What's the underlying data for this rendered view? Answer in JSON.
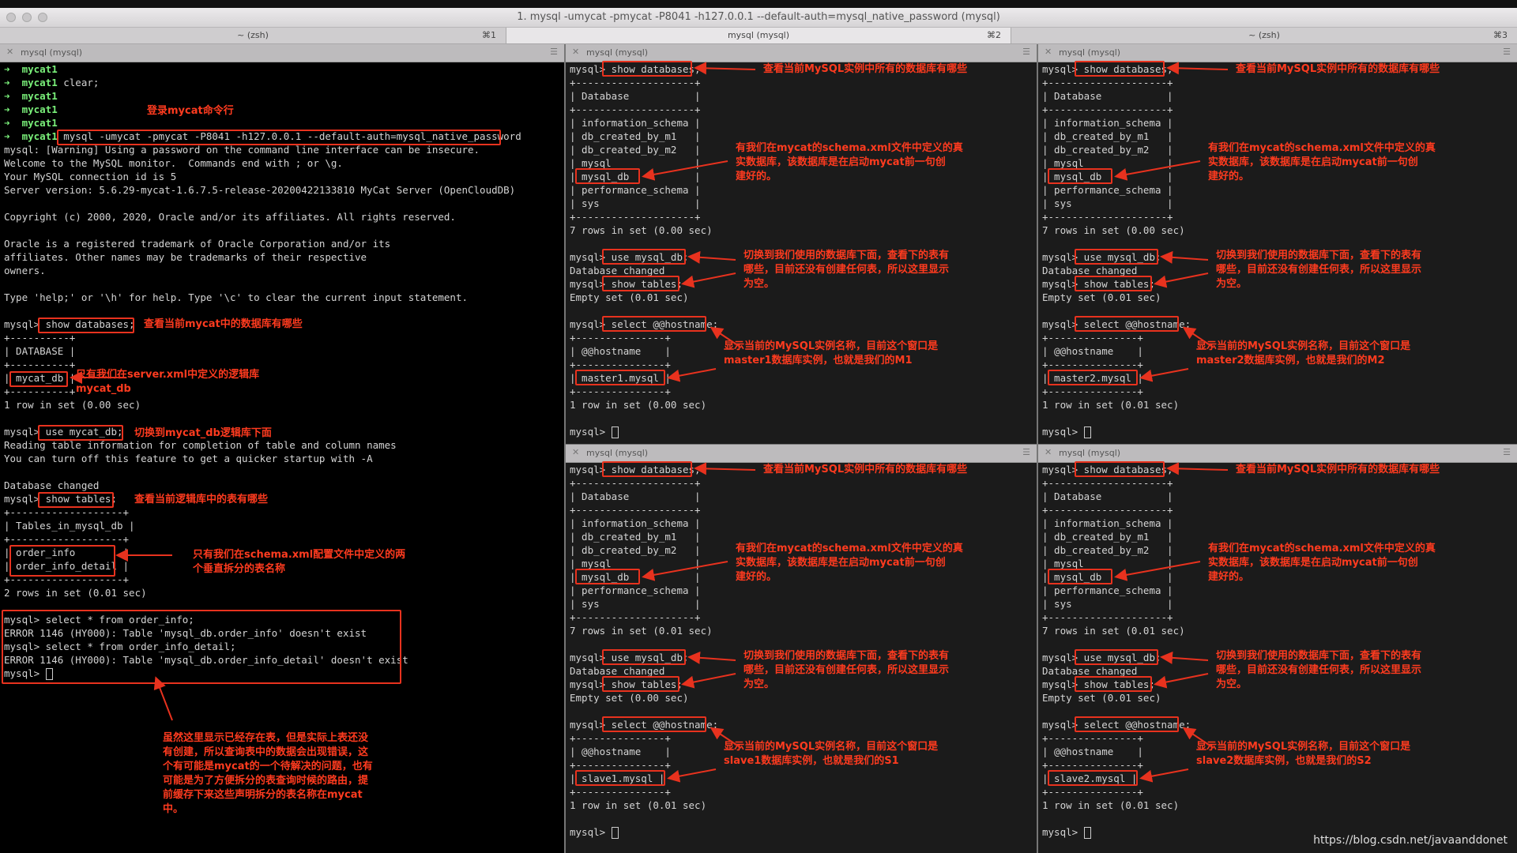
{
  "window": {
    "title": "1. mysql -umycat -pmycat -P8041 -h127.0.0.1 --default-auth=mysql_native_password (mysql)"
  },
  "tabs": [
    {
      "label": "~ (zsh)",
      "shortcut": "⌘1"
    },
    {
      "label": "mysql (mysql)",
      "shortcut": "⌘2"
    },
    {
      "label": "~ (zsh)",
      "shortcut": "⌘3"
    }
  ],
  "pane_title": "mysql (mysql)",
  "left": {
    "lines": [
      "mycat1",
      "mycat1 clear;",
      "mycat1",
      "mycat1",
      "mycat1",
      "mycat1 mysql -umycat -pmycat -P8041 -h127.0.0.1 --default-auth=mysql_native_password",
      "mysql: [Warning] Using a password on the command line interface can be insecure.",
      "Welcome to the MySQL monitor.  Commands end with ; or \\g.",
      "Your MySQL connection id is 5",
      "Server version: 5.6.29-mycat-1.6.7.5-release-20200422133810 MyCat Server (OpenCloudDB)",
      "",
      "Copyright (c) 2000, 2020, Oracle and/or its affiliates. All rights reserved.",
      "",
      "Oracle is a registered trademark of Oracle Corporation and/or its",
      "affiliates. Other names may be trademarks of their respective",
      "owners.",
      "",
      "Type 'help;' or '\\h' for help. Type '\\c' to clear the current input statement.",
      "",
      "mysql> show databases;",
      "+----------+",
      "| DATABASE |",
      "+----------+",
      "| mycat_db |",
      "+----------+",
      "1 row in set (0.00 sec)",
      "",
      "mysql> use mycat_db;",
      "Reading table information for completion of table and column names",
      "You can turn off this feature to get a quicker startup with -A",
      "",
      "Database changed",
      "mysql> show tables;",
      "+-------------------+",
      "| Tables_in_mysql_db |",
      "+-------------------+",
      "| order_info        |",
      "| order_info_detail |",
      "+-------------------+",
      "2 rows in set (0.01 sec)",
      "",
      "mysql> select * from order_info;",
      "ERROR 1146 (HY000): Table 'mysql_db.order_info' doesn't exist",
      "mysql> select * from order_info_detail;",
      "ERROR 1146 (HY000): Table 'mysql_db.order_info_detail' doesn't exist",
      "mysql> "
    ],
    "notes": {
      "login": "登录mycat命令行",
      "show_db": "查看当前mycat中的数据库有哪些",
      "logic_db": "只有我们在server.xml中定义的逻辑库\nmycat_db",
      "use_db": "切换到mycat_db逻辑库下面",
      "show_tables": "查看当前逻辑库中的表有哪些",
      "tables": "只有我们在schema.xml配置文件中定义的两\n个垂直拆分的表名称",
      "error": "虽然这里显示已经存在表，但是实际上表还没\n有创建，所以查询表中的数据会出现错误，这\n个有可能是mycat的一个待解决的问题，也有\n可能是为了方便拆分的表查询时候的路由，提\n前缓存下来这些声明拆分的表名称在mycat\n中。"
    }
  },
  "mysql_panes": [
    {
      "hostname": "master1.mysql",
      "time_show_db": "7 rows in set (0.00 sec)",
      "time_empty": "Empty set (0.01 sec)",
      "time_host": "1 row in set (0.00 sec)",
      "note_host": "显示当前的MySQL实例名称，目前这个窗口是\nmaster1数据库实例，也就是我们的M1"
    },
    {
      "hostname": "master2.mysql",
      "time_show_db": "7 rows in set (0.00 sec)",
      "time_empty": "Empty set (0.01 sec)",
      "time_host": "1 row in set (0.01 sec)",
      "note_host": "显示当前的MySQL实例名称，目前这个窗口是\nmaster2数据库实例，也就是我们的M2"
    },
    {
      "hostname": "slave1.mysql",
      "time_show_db": "7 rows in set (0.01 sec)",
      "time_empty": "Empty set (0.00 sec)",
      "time_host": "1 row in set (0.01 sec)",
      "note_host": "显示当前的MySQL实例名称，目前这个窗口是\nslave1数据库实例，也就是我们的S1"
    },
    {
      "hostname": "slave2.mysql",
      "time_show_db": "7 rows in set (0.01 sec)",
      "time_empty": "Empty set (0.01 sec)",
      "time_host": "1 row in set (0.01 sec)",
      "note_host": "显示当前的MySQL实例名称，目前这个窗口是\nslave2数据库实例，也就是我们的S2"
    }
  ],
  "pane_common": {
    "cmd_show_db": "mysql> show databases;",
    "sep_db": "+--------------------+",
    "head_db": "| Database           |",
    "rows_db": [
      "| information_schema |",
      "| db_created_by_m1   |",
      "| db_created_by_m2   |",
      "| mysql              |",
      "| mysql_db           |",
      "| performance_schema |",
      "| sys                |"
    ],
    "cmd_use": "mysql> use mysql_db;",
    "db_changed": "Database changed",
    "cmd_show_tables": "mysql> show tables;",
    "cmd_host": "mysql> select @@hostname;",
    "sep_host": "+---------------+",
    "head_host": "| @@hostname    |",
    "prompt": "mysql> ",
    "note_show_db": "查看当前MySQL实例中所有的数据库有哪些",
    "note_mysql_db": "有我们在mycat的schema.xml文件中定义的真\n实数据库，该数据库是在启动mycat前一句创\n建好的。",
    "note_use": "切换到我们使用的数据库下面，查看下的表有\n哪些，目前还没有创建任何表，所以这里显示\n为空。"
  },
  "watermark": "https://blog.csdn.net/javaanddonet"
}
